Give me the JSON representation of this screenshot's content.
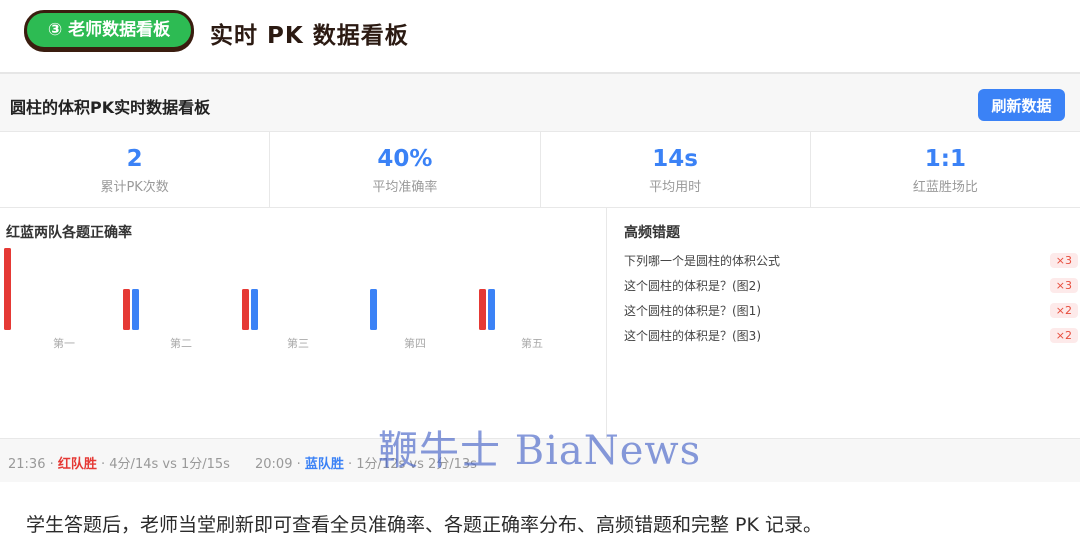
{
  "header": {
    "pill_label": "③ 老师数据看板",
    "title": "实时 PK 数据看板"
  },
  "panel": {
    "title": "圆柱的体积PK实时数据看板",
    "refresh_label": "刷新数据"
  },
  "stats": [
    {
      "value": "2",
      "label": "累计PK次数"
    },
    {
      "value": "40%",
      "label": "平均准确率"
    },
    {
      "value": "14s",
      "label": "平均用时"
    },
    {
      "value": "1:1",
      "label": "红蓝胜场比"
    }
  ],
  "chart_data": {
    "type": "bar",
    "title": "红蓝两队各题正确率",
    "categories": [
      "第一",
      "第二",
      "第三",
      "第四",
      "第五"
    ],
    "series": [
      {
        "color": "#e53935",
        "values": [
          100,
          50,
          50,
          0,
          50
        ]
      },
      {
        "color": "#3b82f6",
        "values": [
          0,
          50,
          50,
          50,
          50
        ]
      }
    ],
    "ylim": [
      0,
      100
    ],
    "grid": false,
    "legend": "none"
  },
  "errors": {
    "title": "高频错题",
    "items": [
      {
        "text": "下列哪一个是圆柱的体积公式",
        "count": "×3"
      },
      {
        "text": "这个圆柱的体积是？(图2)",
        "count": "×3"
      },
      {
        "text": "这个圆柱的体积是？(图1)",
        "count": "×2"
      },
      {
        "text": "这个圆柱的体积是？(图3)",
        "count": "×2"
      }
    ]
  },
  "log": [
    {
      "time": "21:36 · ",
      "winner": "红队胜",
      "detail": " · 4分/14s vs 1分/15s"
    },
    {
      "time": "20:09 · ",
      "winner": "蓝队胜",
      "detail": " · 1分/12s vs 2分/13s"
    }
  ],
  "watermark": "鞭牛士 BiaNews",
  "caption": "学生答题后，老师当堂刷新即可查看全员准确率、各题正确率分布、高频错题和完整 PK 记录。",
  "colors": {
    "accent": "#3b82f6",
    "red": "#e53935",
    "pill": "#2dbb53"
  }
}
